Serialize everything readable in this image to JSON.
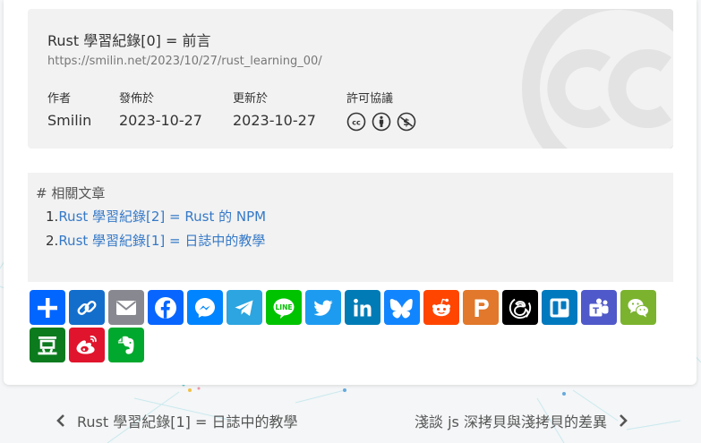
{
  "license": {
    "title": "Rust 學習紀錄[0] = 前言",
    "url": "https://smilin.net/2023/10/27/rust_learning_00/",
    "author_label": "作者",
    "author": "Smilin",
    "published_label": "發佈於",
    "published": "2023-10-27",
    "updated_label": "更新於",
    "updated": "2023-10-27",
    "license_label": "許可協議",
    "license_icons": [
      "cc-icon",
      "by-attribution-icon",
      "noncommercial-icon"
    ]
  },
  "related": {
    "heading": "# 相關文章",
    "items": [
      {
        "num": "1.",
        "title": "Rust 學習紀錄[2] = Rust 的 NPM"
      },
      {
        "num": "2.",
        "title": "Rust 學習紀錄[1] = 日誌中的教學"
      }
    ]
  },
  "share": [
    {
      "name": "share-more",
      "color": "#0166ff",
      "icon": "plus-icon"
    },
    {
      "name": "copy-link",
      "color": "#136ecb",
      "icon": "link-icon"
    },
    {
      "name": "email",
      "color": "#888990",
      "icon": "email-icon"
    },
    {
      "name": "facebook",
      "color": "#0866ff",
      "icon": "facebook-icon"
    },
    {
      "name": "messenger",
      "color": "#0084ff",
      "icon": "messenger-icon"
    },
    {
      "name": "telegram",
      "color": "#2ca5e0",
      "icon": "telegram-icon"
    },
    {
      "name": "line",
      "color": "#00c300",
      "icon": "line-icon"
    },
    {
      "name": "twitter",
      "color": "#1d9bf0",
      "icon": "twitter-icon"
    },
    {
      "name": "linkedin",
      "color": "#007bb5",
      "icon": "linkedin-icon"
    },
    {
      "name": "bluesky",
      "color": "#1185fe",
      "icon": "bluesky-icon"
    },
    {
      "name": "reddit",
      "color": "#ff4500",
      "icon": "reddit-icon"
    },
    {
      "name": "pinboard",
      "color": "#e1782b",
      "icon": "pinboard-icon"
    },
    {
      "name": "threads",
      "color": "#000000",
      "icon": "threads-icon"
    },
    {
      "name": "trello",
      "color": "#0079bf",
      "icon": "trello-icon"
    },
    {
      "name": "teams",
      "color": "#5059c9",
      "icon": "teams-icon"
    },
    {
      "name": "wechat",
      "color": "#7bb32e",
      "icon": "wechat-icon"
    },
    {
      "name": "douban",
      "color": "#0b7b1e",
      "icon": "douban-icon"
    },
    {
      "name": "weibo",
      "color": "#e0142c",
      "icon": "weibo-icon"
    },
    {
      "name": "evernote",
      "color": "#00a82d",
      "icon": "evernote-icon"
    }
  ],
  "nav": {
    "prev": "Rust 學習紀錄[1] = 日誌中的教學",
    "next": "淺談 js 深拷貝與淺拷貝的差異"
  }
}
